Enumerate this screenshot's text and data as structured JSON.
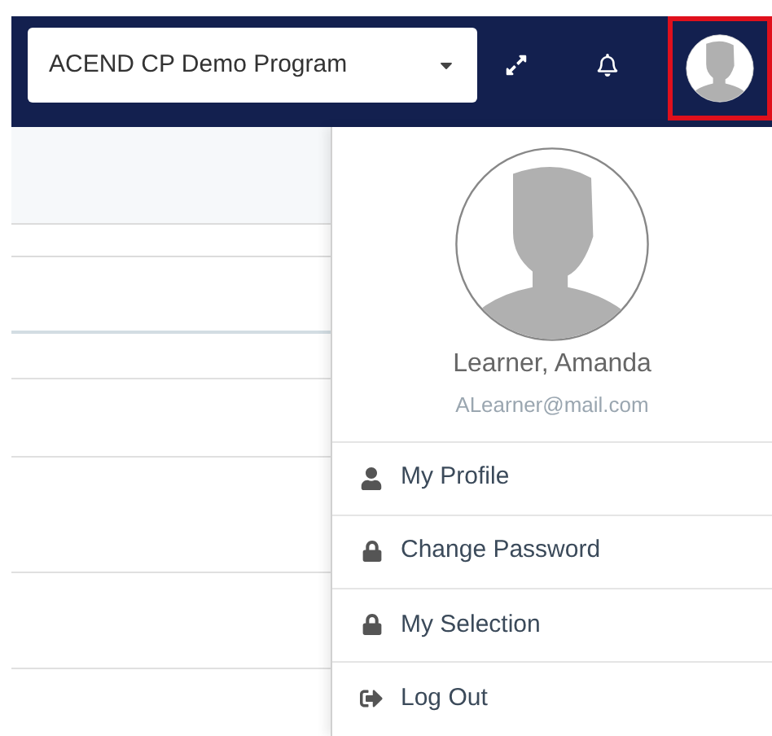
{
  "program_select": {
    "value": "ACEND CP Demo Program"
  },
  "user_menu": {
    "open": true,
    "name": "Learner, Amanda",
    "email": "ALearner@mail.com",
    "items": [
      {
        "kind": "profile",
        "label": "My Profile"
      },
      {
        "kind": "password",
        "label": "Change Password"
      },
      {
        "kind": "selection",
        "label": "My Selection"
      },
      {
        "kind": "logout",
        "label": "Log Out"
      }
    ]
  }
}
